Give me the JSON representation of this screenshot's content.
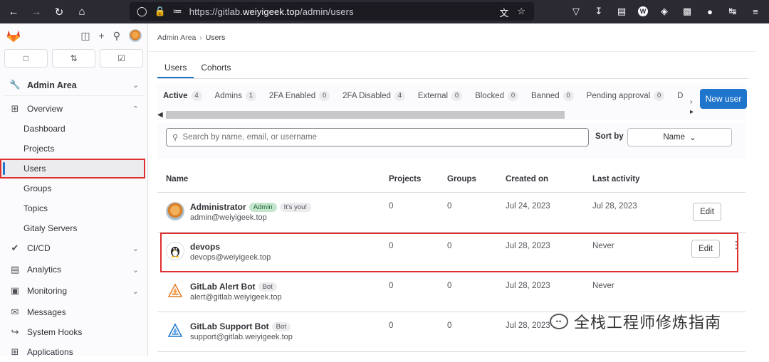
{
  "browser": {
    "url_prefix": "https://gitlab.",
    "url_domain": "weiyigeek.top",
    "url_path": "/admin/users"
  },
  "sidebar": {
    "section_title": "Admin Area",
    "overview": "Overview",
    "sub_items": [
      "Dashboard",
      "Projects",
      "Users",
      "Groups",
      "Topics",
      "Gitaly Servers"
    ],
    "items": [
      "CI/CD",
      "Analytics",
      "Monitoring",
      "Messages",
      "System Hooks",
      "Applications"
    ]
  },
  "breadcrumb": {
    "parent": "Admin Area",
    "current": "Users"
  },
  "tabs": [
    "Users",
    "Cohorts"
  ],
  "subtabs": [
    {
      "label": "Active",
      "count": "4"
    },
    {
      "label": "Admins",
      "count": "1"
    },
    {
      "label": "2FA Enabled",
      "count": "0"
    },
    {
      "label": "2FA Disabled",
      "count": "4"
    },
    {
      "label": "External",
      "count": "0"
    },
    {
      "label": "Blocked",
      "count": "0"
    },
    {
      "label": "Banned",
      "count": "0"
    },
    {
      "label": "Pending approval",
      "count": "0"
    },
    {
      "label": "D",
      "count": ""
    }
  ],
  "new_user_label": "New user",
  "search": {
    "placeholder": "Search by name, email, or username"
  },
  "sort": {
    "label": "Sort by",
    "value": "Name"
  },
  "table": {
    "headers": [
      "Name",
      "Projects",
      "Groups",
      "Created on",
      "Last activity"
    ],
    "rows": [
      {
        "name": "Administrator",
        "badges": [
          "Admin",
          "It's you!"
        ],
        "email": "admin@weiyigeek.top",
        "projects": "0",
        "groups": "0",
        "created": "Jul 24, 2023",
        "last": "Jul 28, 2023",
        "edit": "Edit"
      },
      {
        "name": "devops",
        "badges": [],
        "email": "devops@weiyigeek.top",
        "projects": "0",
        "groups": "0",
        "created": "Jul 28, 2023",
        "last": "Never",
        "edit": "Edit"
      },
      {
        "name": "GitLab Alert Bot",
        "badges": [
          "Bot"
        ],
        "email": "alert@gitlab.weiyigeek.top",
        "projects": "0",
        "groups": "0",
        "created": "Jul 28, 2023",
        "last": "Never",
        "edit": ""
      },
      {
        "name": "GitLab Support Bot",
        "badges": [
          "Bot"
        ],
        "email": "support@gitlab.weiyigeek.top",
        "projects": "0",
        "groups": "0",
        "created": "Jul 28, 2023",
        "last": "",
        "edit": ""
      }
    ]
  },
  "watermark": "全栈工程师修炼指南",
  "colors": {
    "accent": "#1f75cb",
    "highlight": "#e02f2f",
    "browser_bar": "#2b2a33"
  }
}
